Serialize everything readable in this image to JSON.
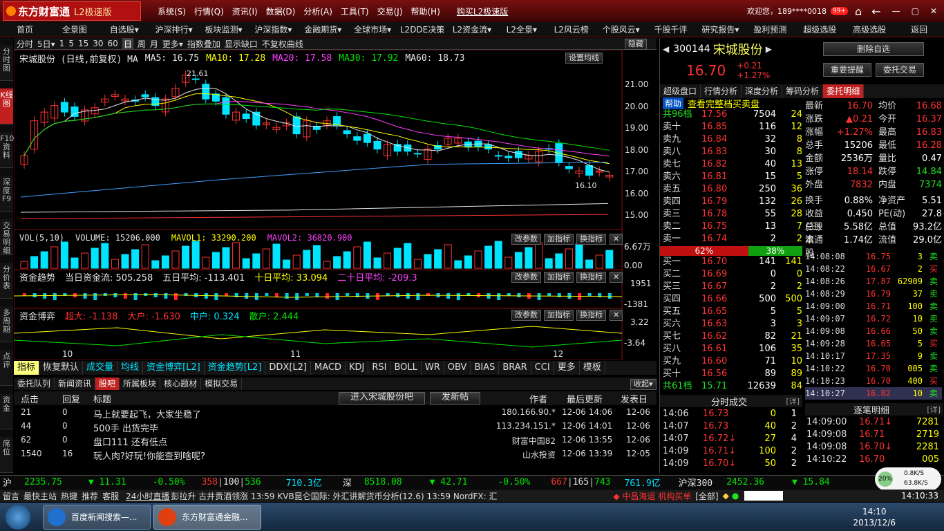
{
  "app": {
    "title": "L2极速版",
    "logo": "东方财富通",
    "menus": [
      "系统(S)",
      "行情(Q)",
      "资讯(I)",
      "数据(D)",
      "分析(A)",
      "工具(T)",
      "交易(J)",
      "帮助(H)"
    ],
    "buy": "购买L2极速版",
    "welcome": "欢迎您，189****0018",
    "badge": "99+"
  },
  "nav": [
    "首页",
    "全景图",
    "自选股▾",
    "沪深排行▾",
    "板块监测▾",
    "沪深指数▾",
    "金融期货▾",
    "全球市场▾",
    "L2DDE决策",
    "L2资金流▾",
    "L2全景▾",
    "L2风云榜",
    "个股风云▾",
    "千股千评",
    "研究报告▾",
    "盈利预测",
    "超级选股",
    "高级选股",
    "返回"
  ],
  "periods": [
    "分时",
    "5日▾",
    "1",
    "5",
    "15",
    "30",
    "60",
    "日",
    "周",
    "月",
    "更多▾",
    "指数叠加",
    "显示缺口",
    "不复权曲线"
  ],
  "hide": "隐藏",
  "vtabs": [
    "分时图",
    "K线图",
    "F10资料",
    "深度F9",
    "交易明细",
    "分价表",
    "多周期",
    "点评",
    "资金",
    "席位"
  ],
  "ma_line": {
    "name": "宋城股份 (日线,前复权) MA",
    "ma5": "MA5: 16.75",
    "ma10": "MA10: 17.28",
    "ma20": "MA20: 17.58",
    "ma30": "MA30: 17.92",
    "ma60": "MA60: 18.73",
    "set": "设置均线"
  },
  "price_axis": [
    "21.00",
    "20.00",
    "19.00",
    "18.00",
    "17.00",
    "16.00",
    "15.00"
  ],
  "hi_label": "21.61",
  "lo_label": "16.10",
  "vol": {
    "title": "VOL(5,10)",
    "volume": "VOLUME: 15206.000",
    "mavol1": "MAVOL1: 33290.200",
    "mavol2": "MAVOL2: 36820.900",
    "axis1": "6.67万",
    "axis2": "0.00"
  },
  "cap": {
    "title": "资金趋势",
    "t1": "当日资金流: 505.258",
    "t2": "五日平均: -113.401",
    "t3": "十日平均: 33.094",
    "t4": "二十日平均: -209.3",
    "axis1": "1951",
    "axis2": "-1381"
  },
  "game": {
    "title": "资金博弈",
    "t1": "超大: -1.138",
    "t2": "大户: -1.630",
    "t3": "中户: 0.324",
    "t4": "散户: 2.444",
    "axis1": "3.22",
    "axis2": "-3.64"
  },
  "panel_btns": [
    "改参数",
    "加指标",
    "换指标"
  ],
  "xlabels": [
    "10",
    "11",
    "12"
  ],
  "ind_tabs": [
    "指标",
    "恢复默认",
    "成交量",
    "均线",
    "资金博弈[L2]",
    "资金趋势[L2]",
    "DDX[L2]",
    "MACD",
    "KDJ",
    "RSI",
    "BOLL",
    "WR",
    "OBV",
    "BIAS",
    "BRAR",
    "CCI",
    "更多",
    "模板"
  ],
  "sub_tabs": [
    "委托队列",
    "新闻资讯",
    "股吧",
    "所属板块",
    "核心题材",
    "模拟交易"
  ],
  "fold": "收起▾",
  "forum": {
    "headers": [
      "点击",
      "回复",
      "标题",
      "作者",
      "最后更新",
      "发表日"
    ],
    "enter": "进入宋城股份吧",
    "post": "发新帖",
    "rows": [
      [
        "21",
        "0",
        "马上就要起飞，大家坐稳了",
        "180.166.90.*",
        "12-06 14:06",
        "12-06"
      ],
      [
        "44",
        "0",
        "500手 出货完毕",
        "113.234.151.*",
        "12-06 14:01",
        "12-06"
      ],
      [
        "62",
        "0",
        "盘口111 还有低点",
        "财富中国82",
        "12-06 13:55",
        "12-06"
      ],
      [
        "1540",
        "16",
        "玩人肉?好玩!你能查到啥呢?",
        "山水投资",
        "12-06 13:39",
        "12-05"
      ]
    ]
  },
  "stock": {
    "code": "300144",
    "name": "宋城股份",
    "price": "16.70",
    "chg": "+0.21",
    "pct": "+1.27%",
    "btns": [
      "删除自选",
      "重要提醒",
      "委托交易"
    ]
  },
  "rtabs": [
    "超级盘口",
    "行情分析",
    "深度分析",
    "筹码分析",
    "委托明细"
  ],
  "help": "帮助",
  "fullq": "查看完整档买卖盘",
  "sell": [
    [
      "共96档",
      "17.56",
      "7504",
      "24"
    ],
    [
      "卖十",
      "16.85",
      "116",
      "12"
    ],
    [
      "卖九",
      "16.84",
      "32",
      "8"
    ],
    [
      "卖八",
      "16.83",
      "30",
      "8"
    ],
    [
      "卖七",
      "16.82",
      "40",
      "13"
    ],
    [
      "卖六",
      "16.81",
      "15",
      "5"
    ],
    [
      "卖五",
      "16.80",
      "250",
      "36"
    ],
    [
      "卖四",
      "16.79",
      "132",
      "26"
    ],
    [
      "卖三",
      "16.78",
      "55",
      "28"
    ],
    [
      "卖二",
      "16.75",
      "13",
      "7"
    ],
    [
      "卖一",
      "16.74",
      "2",
      "2"
    ]
  ],
  "ratio": [
    "62%",
    "38%"
  ],
  "buy": [
    [
      "买一",
      "16.70",
      "141",
      "141"
    ],
    [
      "买二",
      "16.69",
      "0",
      "0"
    ],
    [
      "买三",
      "16.67",
      "2",
      "2"
    ],
    [
      "买四",
      "16.66",
      "500",
      "500"
    ],
    [
      "买五",
      "16.65",
      "5",
      "5"
    ],
    [
      "买六",
      "16.63",
      "3",
      "3"
    ],
    [
      "买七",
      "16.62",
      "82",
      "21"
    ],
    [
      "买八",
      "16.61",
      "106",
      "35"
    ],
    [
      "买九",
      "16.60",
      "71",
      "10"
    ],
    [
      "买十",
      "16.56",
      "89",
      "89"
    ],
    [
      "共61档",
      "15.71",
      "12639",
      "84"
    ]
  ],
  "stats": [
    [
      "最新",
      "16.70",
      "均价",
      "16.68"
    ],
    [
      "涨跌",
      "▲0.21",
      "今开",
      "16.37"
    ],
    [
      "涨幅",
      "+1.27%",
      "最高",
      "16.83"
    ],
    [
      "总手",
      "15206",
      "最低",
      "16.28"
    ],
    [
      "金额",
      "2536万",
      "量比",
      "0.47"
    ],
    [
      "涨停",
      "18.14",
      "跌停",
      "14.84"
    ],
    [
      "外盘",
      "7832",
      "内盘",
      "7374"
    ],
    [
      "换手",
      "0.88%",
      "净资产",
      "5.51"
    ],
    [
      "收益(三)",
      "0.450",
      "PE(动)",
      "27.8"
    ],
    [
      "总股本",
      "5.58亿",
      "总值",
      "93.2亿"
    ],
    [
      "流通股",
      "1.74亿",
      "流值",
      "29.0亿"
    ]
  ],
  "ticks": [
    [
      "14:08:08",
      "16.75",
      "3",
      "卖"
    ],
    [
      "14:08:22",
      "16.67",
      "2",
      "买"
    ],
    [
      "14:08:26",
      "17.87",
      "62909",
      "卖"
    ],
    [
      "14:08:29",
      "16.79",
      "37",
      "卖"
    ],
    [
      "14:09:00",
      "16.71",
      "100",
      "卖"
    ],
    [
      "14:09:07",
      "16.72",
      "10",
      "卖"
    ],
    [
      "14:09:08",
      "16.66",
      "50",
      "卖"
    ],
    [
      "14:09:28",
      "16.65",
      "5",
      "买"
    ],
    [
      "14:10:17",
      "17.35",
      "9",
      "卖"
    ],
    [
      "14:10:22",
      "16.70",
      "005",
      "卖"
    ],
    [
      "14:10:23",
      "16.70",
      "400",
      "买"
    ],
    [
      "14:10:27",
      "16.82",
      "10",
      "卖"
    ]
  ],
  "fs_title": "分时成交",
  "detail": "[详]",
  "zb_title": "逐笔明细",
  "fs": [
    [
      "14:06",
      "16.73",
      "0",
      "1"
    ],
    [
      "14:07",
      "16.73",
      "40",
      "2"
    ],
    [
      "14:07",
      "16.72↓",
      "27",
      "4"
    ],
    [
      "14:09",
      "16.71↓",
      "100",
      "2"
    ],
    [
      "14:09",
      "16.70↓",
      "50",
      "2"
    ]
  ],
  "zb": [
    [
      "14:09:00",
      "16.71↓",
      "7281"
    ],
    [
      "14:09:08",
      "16.71",
      "2719"
    ],
    [
      "14:09:08",
      "16.70↓",
      "2281"
    ],
    [
      "14:10:22",
      "16.70",
      "005"
    ]
  ],
  "idx": {
    "sh": "沪",
    "shv": "2235.75",
    "shc": "▼ 11.31",
    "shp": "-0.50%",
    "sh1": "358",
    "sh2": "100",
    "sh3": "536",
    "sha": "710.3亿",
    "sz": "深",
    "szv": "8518.08",
    "szc": "▼ 42.71",
    "szp": "-0.50%",
    "sz1": "667",
    "sz2": "165",
    "sz3": "743",
    "sza": "761.9亿",
    "hs": "沪深300",
    "hsv": "2452.36",
    "hsc": "▼ 15.84"
  },
  "net": {
    "pct": "20%",
    "up": "0.8K/S",
    "down": "63.8K/S"
  },
  "status": {
    "items": [
      "留言",
      "最快主站",
      "热键",
      "推荐",
      "客服"
    ],
    "live": "24小时直播",
    "ticker": "彭拉升  古井贡酒领涨     13:59 KVB昆仑国际: 外汇讲解货币分析(12.6)     13:59 NordFX: 汇",
    "news": "◆ 中昌海运 机构买单",
    "all": "[全部]",
    "clock": "14:10:33"
  },
  "taskbar": {
    "t1": "百度新闻搜索—...",
    "t2": "东方财富通金融...",
    "time": "14:10",
    "date": "2013/12/6"
  }
}
